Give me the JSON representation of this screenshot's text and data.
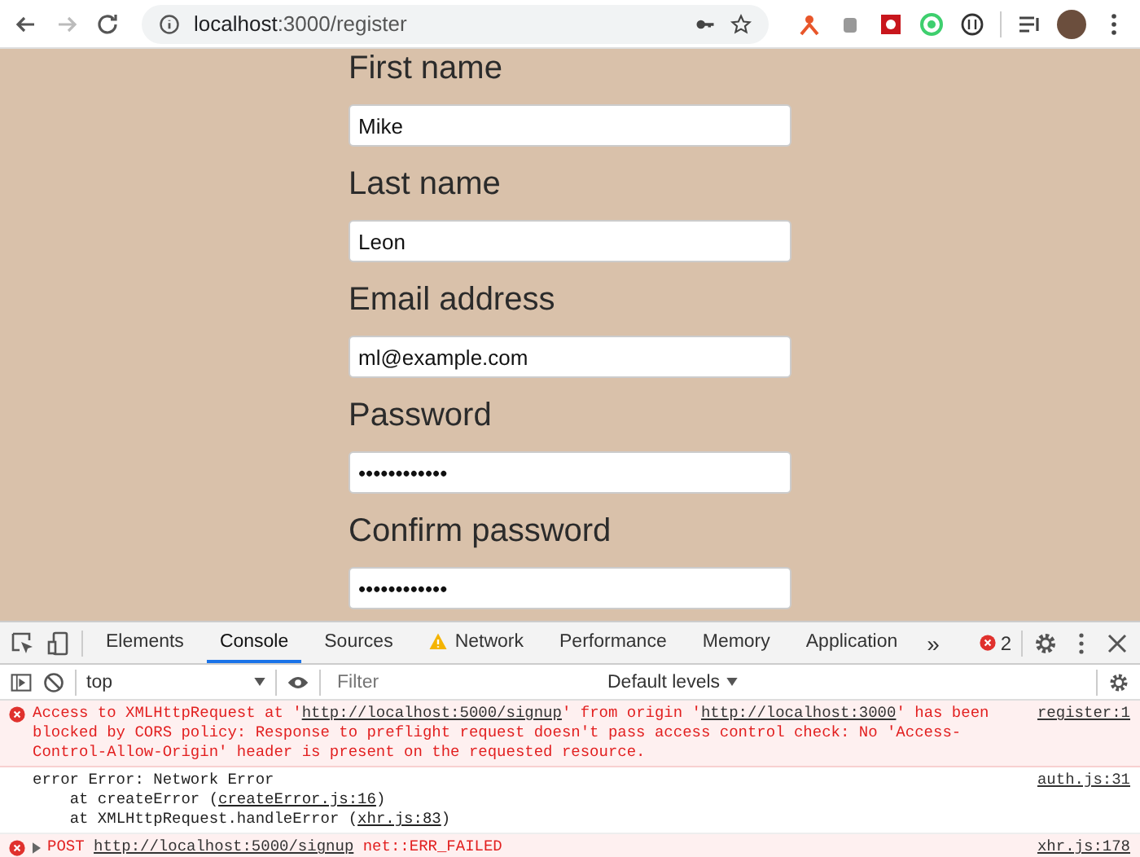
{
  "browser": {
    "url": "**localhost**:3000/register"
  },
  "form": {
    "fields": [
      {
        "label": "First name",
        "value": "Mike"
      },
      {
        "label": "Last name",
        "value": "Leon"
      },
      {
        "label": "Email address",
        "value": "ml@example.com"
      },
      {
        "label": "Password",
        "value": "••••••••••••"
      },
      {
        "label": "Confirm password",
        "value": "••••••••••••"
      }
    ]
  },
  "devtools": {
    "tabs": [
      {
        "label": "Elements",
        "selected": false,
        "warning": false
      },
      {
        "label": "Console",
        "selected": true,
        "warning": false
      },
      {
        "label": "Sources",
        "selected": false,
        "warning": false
      },
      {
        "label": "Network",
        "selected": false,
        "warning": true
      },
      {
        "label": "Performance",
        "selected": false,
        "warning": false
      },
      {
        "label": "Memory",
        "selected": false,
        "warning": false
      },
      {
        "label": "Application",
        "selected": false,
        "warning": false
      }
    ],
    "more": "»",
    "error_count": "2",
    "console_toolbar": {
      "context": "top",
      "filter_placeholder": "Filter",
      "levels": "Default levels"
    },
    "messages": [
      {
        "kind": "error",
        "expandable": false,
        "source": "register:1",
        "lines": [
          [
            {
              "text": "Access to XMLHttpRequest at '",
              "link": false
            },
            {
              "text": "http://localhost:5000/signup",
              "link": true
            },
            {
              "text": "' from origin '",
              "link": false
            },
            {
              "text": "http://localhost:3000",
              "link": true
            },
            {
              "text": "' has been blocked by CORS policy: Response to preflight request doesn't pass access control check: No 'Access-Control-Allow-Origin' header is present on the requested resource.",
              "link": false
            }
          ]
        ]
      },
      {
        "kind": "log",
        "expandable": false,
        "source": "auth.js:31",
        "lines": [
          [
            {
              "text": "error Error: Network Error",
              "link": false
            }
          ],
          [
            {
              "text": "    at createError (",
              "link": false
            },
            {
              "text": "createError.js:16",
              "link": true
            },
            {
              "text": ")",
              "link": false
            }
          ],
          [
            {
              "text": "    at XMLHttpRequest.handleError (",
              "link": false
            },
            {
              "text": "xhr.js:83",
              "link": true
            },
            {
              "text": ")",
              "link": false
            }
          ]
        ]
      },
      {
        "kind": "error",
        "expandable": true,
        "source": "xhr.js:178",
        "lines": [
          [
            {
              "text": "POST ",
              "link": false
            },
            {
              "text": "http://localhost:5000/signup",
              "link": true
            },
            {
              "text": " net::ERR_FAILED",
              "link": false
            }
          ]
        ]
      }
    ]
  }
}
